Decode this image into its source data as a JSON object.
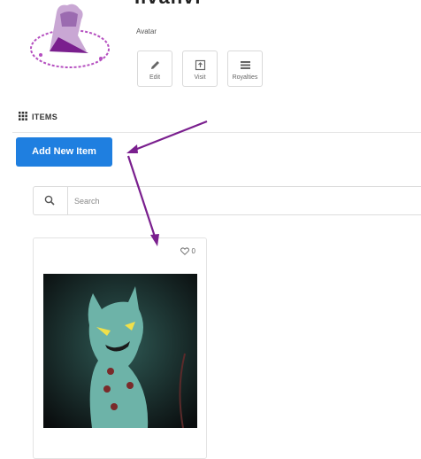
{
  "profile": {
    "title_fragment": "Ilvanvi",
    "avatar_label": "Avatar"
  },
  "actions": {
    "edit": "Edit",
    "visit": "Visit",
    "royalties": "Royalties"
  },
  "items_section": {
    "header": "ITEMS",
    "add_button": "Add New Item"
  },
  "search": {
    "placeholder": "Search",
    "value": ""
  },
  "item_card": {
    "like_count": "0"
  },
  "colors": {
    "primary_button": "#1f7fe0",
    "annotation_arrow": "#7a1f8e"
  },
  "icons": [
    "pencil-icon",
    "visit-icon",
    "list-icon",
    "grid-icon",
    "search-icon",
    "heart-icon"
  ]
}
